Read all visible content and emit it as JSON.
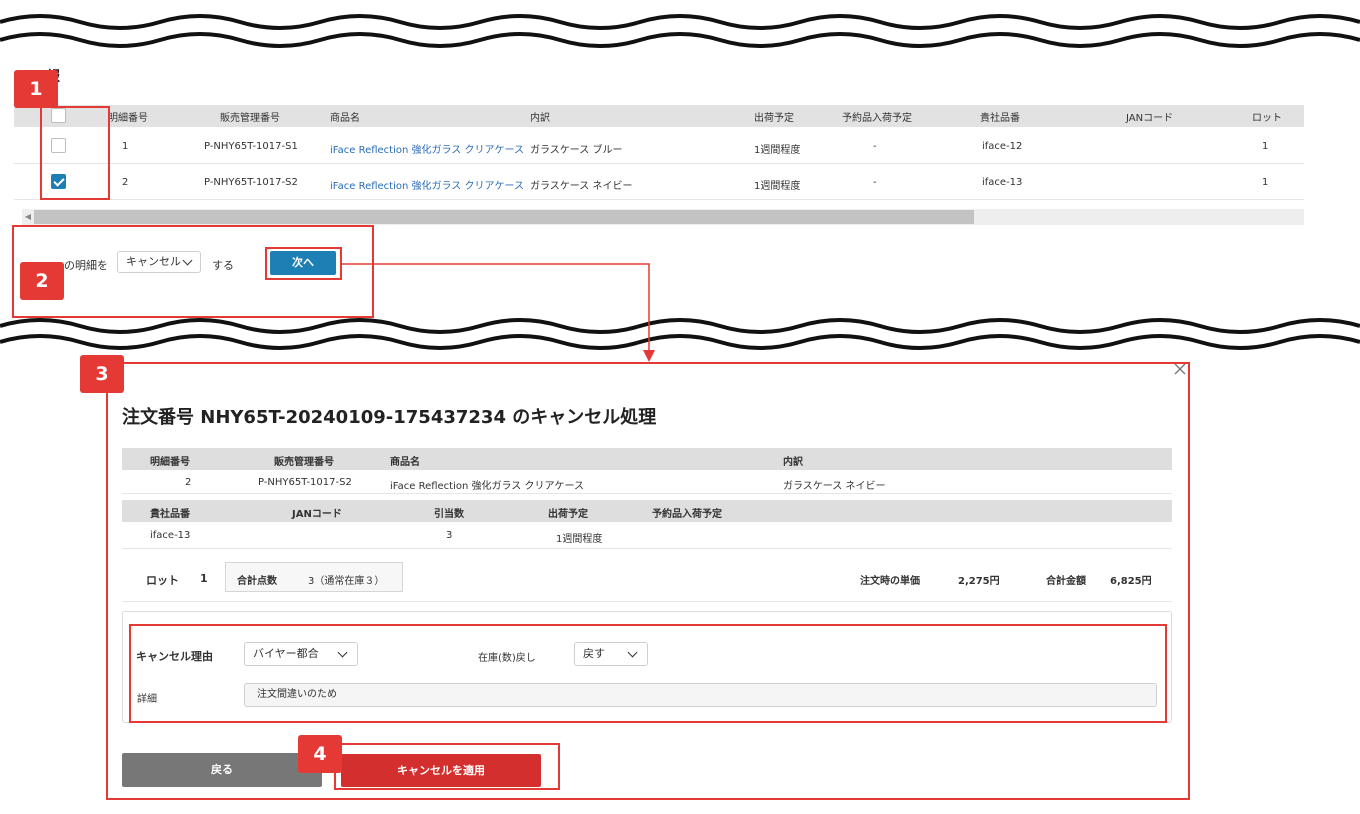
{
  "section1": {
    "title": "報",
    "columns": [
      "明細番号",
      "販売管理番号",
      "商品名",
      "内訳",
      "出荷予定",
      "予約品入荷予定",
      "貴社品番",
      "JANコード",
      "ロット"
    ],
    "rows": [
      {
        "checked": false,
        "no": "1",
        "sales_no": "P-NHY65T-1017-S1",
        "product": "iFace Reflection 強化ガラス クリアケース",
        "breakdown": "ガラスケース ブルー",
        "ship": "1週間程度",
        "reserve": "-",
        "part_no": "iface-12",
        "jan": "",
        "lot": "1"
      },
      {
        "checked": true,
        "no": "2",
        "sales_no": "P-NHY65T-1017-S2",
        "product": "iFace Reflection 強化ガラス クリアケース",
        "breakdown": "ガラスケース ネイビー",
        "ship": "1週間程度",
        "reserve": "-",
        "part_no": "iface-13",
        "jan": "",
        "lot": "1"
      }
    ],
    "scrollbar_fraction": 0.74
  },
  "action_bar": {
    "prefix": "の明細を",
    "select_value": "キャンセル",
    "suffix": "する",
    "next_label": "次へ"
  },
  "badges": [
    "1",
    "2",
    "3",
    "4"
  ],
  "dialog": {
    "title": "注文番号 NHY65T-20240109-175437234 のキャンセル処理",
    "head1": [
      "明細番号",
      "販売管理番号",
      "商品名",
      "内訳"
    ],
    "row1": {
      "no": "2",
      "sales_no": "P-NHY65T-1017-S2",
      "product": "iFace Reflection 強化ガラス クリアケース",
      "breakdown": "ガラスケース ネイビー"
    },
    "head2": [
      "貴社品番",
      "JANコード",
      "引当数",
      "出荷予定",
      "予約品入荷予定"
    ],
    "row2": {
      "part_no": "iface-13",
      "jan": "",
      "alloc": "3",
      "ship": "1週間程度",
      "reserve": ""
    },
    "totals": {
      "lot_label": "ロット",
      "lot_value": "1",
      "qty_label": "合計点数",
      "qty_value": "3（通常在庫３）",
      "unit_price_label": "注文時の単価",
      "unit_price_value": "2,275円",
      "total_label": "合計金額",
      "total_value": "6,825円"
    },
    "form": {
      "reason_label": "キャンセル理由",
      "reason_value": "バイヤー都合",
      "stock_label": "在庫(数)戻し",
      "stock_value": "戻す",
      "detail_label": "詳細",
      "detail_value": "注文間違いのため"
    },
    "back_label": "戻る",
    "apply_label": "キャンセルを適用"
  },
  "colors": {
    "accent": "#1e7fb4",
    "danger": "#d32f2f",
    "annotation": "#e53935",
    "link": "#2a6db5"
  }
}
